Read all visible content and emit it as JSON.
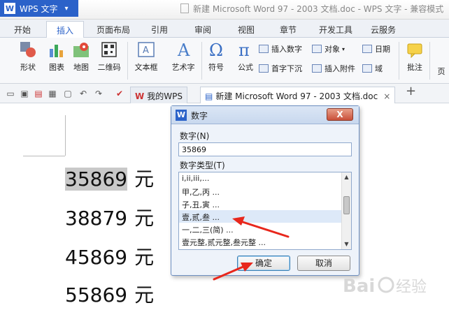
{
  "titlebar": {
    "app_logo": "W",
    "app_name": "WPS 文字",
    "dropdown": "▾",
    "doc_title": "新建 Microsoft Word 97 - 2003 文档.doc - WPS 文字 - 兼容模式"
  },
  "menu": {
    "tabs": [
      {
        "label": "开始"
      },
      {
        "label": "插入",
        "active": true
      },
      {
        "label": "页面布局"
      },
      {
        "label": "引用"
      },
      {
        "label": "审阅"
      },
      {
        "label": "视图"
      },
      {
        "label": "章节"
      },
      {
        "label": "开发工具"
      },
      {
        "label": "云服务"
      }
    ]
  },
  "ribbon": {
    "big_buttons": [
      {
        "label": "形状",
        "icon": "shapes-icon"
      },
      {
        "label": "图表",
        "icon": "chart-icon"
      },
      {
        "label": "地图",
        "icon": "map-icon"
      },
      {
        "label": "二维码",
        "icon": "qrcode-icon"
      },
      {
        "label": "文本框",
        "icon": "textbox-icon"
      },
      {
        "label": "艺术字",
        "icon": "wordart-icon"
      },
      {
        "label": "符号",
        "icon": "omega-icon"
      },
      {
        "label": "公式",
        "icon": "pi-icon"
      },
      {
        "label": "批注",
        "icon": "comment-icon"
      },
      {
        "label": "页"
      }
    ],
    "small_buttons": [
      {
        "label": "插入数字"
      },
      {
        "label": "对象"
      },
      {
        "label": "日期"
      },
      {
        "label": "首字下沉"
      },
      {
        "label": "插入附件"
      },
      {
        "label": "域"
      }
    ]
  },
  "doc_tabs": {
    "tabs": [
      {
        "label": "我的WPS"
      },
      {
        "label": "新建 Microsoft Word 97 - 2003 文档.doc",
        "active": true
      }
    ],
    "close": "×",
    "add": "+"
  },
  "document": {
    "lines": [
      {
        "number": "35869",
        "unit": "元",
        "selected": true
      },
      {
        "number": "38879",
        "unit": "元"
      },
      {
        "number": "45869",
        "unit": "元"
      },
      {
        "number": "55869",
        "unit": "元"
      }
    ]
  },
  "dialog": {
    "icon": "W",
    "title": "数字",
    "close": "X",
    "number_label": "数字(N)",
    "number_value": "35869",
    "type_label": "数字类型(T)",
    "options": [
      {
        "label": "i,ii,iii,..."
      },
      {
        "label": "甲,乙,丙 ..."
      },
      {
        "label": "子,丑,寅 ..."
      },
      {
        "label": "壹,贰,叁 ...",
        "selected": true
      },
      {
        "label": "一,二,三(简) ..."
      },
      {
        "label": "壹元整,贰元整,叁元整 ..."
      }
    ],
    "ok": "确定",
    "cancel": "取消"
  },
  "colors": {
    "accent": "#2b62c9",
    "arrow": "#e8271c",
    "selection": "#c9c9c9"
  }
}
